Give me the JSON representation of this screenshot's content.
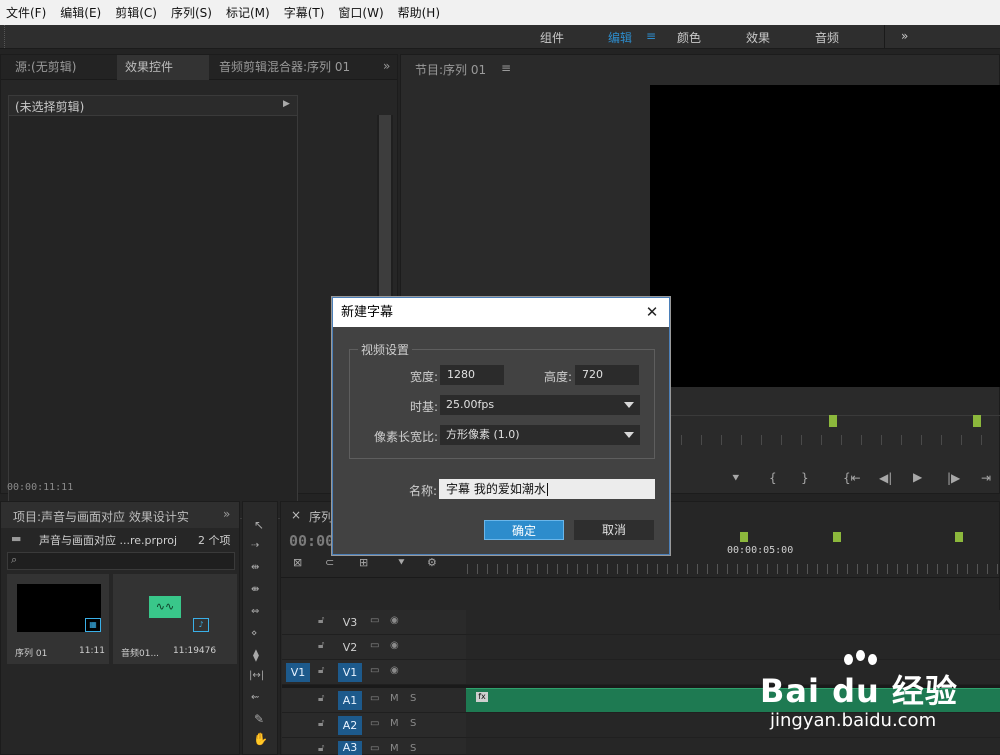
{
  "menu": [
    "文件(F)",
    "编辑(E)",
    "剪辑(C)",
    "序列(S)",
    "标记(M)",
    "字幕(T)",
    "窗口(W)",
    "帮助(H)"
  ],
  "workspaces": {
    "items": [
      "组件",
      "编辑",
      "颜色",
      "效果",
      "音频"
    ],
    "active": "编辑",
    "more": "»"
  },
  "source_panel": {
    "tabs": [
      "源:(无剪辑)",
      "效果控件",
      "音频剪辑混合器:序列 01"
    ],
    "more": "»",
    "no_clip": "(未选择剪辑)",
    "timecode": "00:00:11:11"
  },
  "program_panel": {
    "tab": "节目:序列 01",
    "menu": "≡"
  },
  "project_panel": {
    "tab": "项目:声音与画面对应 效果设计实",
    "more": "»",
    "file": "声音与画面对应 ...re.prproj",
    "count": "2 个项",
    "items": [
      {
        "name": "序列 01",
        "duration": "11:11"
      },
      {
        "name": "音频01...",
        "duration": "11:19476"
      }
    ]
  },
  "timeline": {
    "tab": "序列",
    "close": "×",
    "timecode": "00:00",
    "ruler_label": "00:00:05:00",
    "video_tracks": [
      {
        "name": "V3",
        "src": "",
        "targeted": false
      },
      {
        "name": "V2",
        "src": "",
        "targeted": false
      },
      {
        "name": "V1",
        "src": "V1",
        "targeted": true
      }
    ],
    "audio_tracks": [
      {
        "name": "A1",
        "m": "M",
        "s": "S"
      },
      {
        "name": "A2",
        "m": "M",
        "s": "S"
      },
      {
        "name": "A3",
        "m": "M",
        "s": "S"
      }
    ],
    "clip_label": "fx"
  },
  "dialog": {
    "title": "新建字幕",
    "close": "✕",
    "group_label": "视频设置",
    "width_label": "宽度:",
    "width_value": "1280",
    "height_label": "高度:",
    "height_value": "720",
    "timebase_label": "时基:",
    "timebase_value": "25.00fps",
    "pixel_label": "像素长宽比:",
    "pixel_value": "方形像素 (1.0)",
    "name_label": "名称:",
    "name_value": "字幕 我的爱如潮水",
    "ok": "确定",
    "cancel": "取消"
  },
  "watermark": {
    "brand": "Bai du 经验",
    "url": "jingyan.baidu.com"
  },
  "colors": {
    "accent": "#2d8ccc",
    "track_target": "#1d5a8c",
    "audio_clip": "#1e7a52",
    "marker": "#8cb83c"
  }
}
